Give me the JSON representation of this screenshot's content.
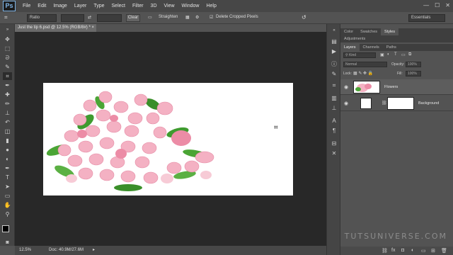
{
  "app": {
    "logo": "Ps"
  },
  "menu": [
    "File",
    "Edit",
    "Image",
    "Layer",
    "Type",
    "Select",
    "Filter",
    "3D",
    "View",
    "Window",
    "Help"
  ],
  "window_controls": {
    "minimize": "—",
    "maximize": "☐",
    "close": "✕"
  },
  "options_bar": {
    "tool_icon": "crop-icon",
    "ratio_value": "Ratio",
    "clear_label": "Clear",
    "straighten_label": "Straighten",
    "delete_cropped_label": "Delete Cropped Pixels",
    "workspace": "Essentials"
  },
  "document": {
    "tab_title": "Just the tip 6.psd @ 12.5% (RGB/8#) *",
    "tab_close": "×"
  },
  "status": {
    "zoom": "12.5%",
    "doc_info": "Doc: 40.9M/27.6M"
  },
  "panels": {
    "top_tabs": [
      "Color",
      "Swatches",
      "Styles"
    ],
    "adjustments_tab": "Adjustments",
    "layers_tabs": [
      "Layers",
      "Channels",
      "Paths"
    ],
    "kind_filter": "Kind",
    "blend_mode": "Normal",
    "opacity_label": "Opacity:",
    "opacity_value": "100%",
    "lock_label": "Lock:",
    "fill_label": "Fill:",
    "fill_value": "100%",
    "layers": [
      {
        "name": "Flowers"
      },
      {
        "name": "Background"
      }
    ]
  },
  "watermark": "TUTSUNIVERSE.COM"
}
